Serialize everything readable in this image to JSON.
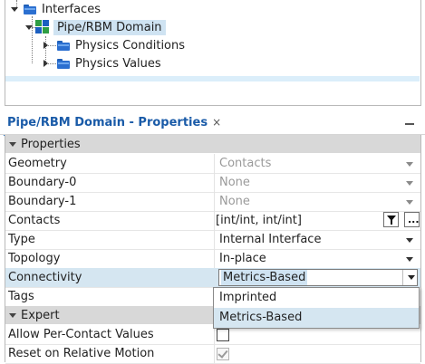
{
  "tree": {
    "items": [
      {
        "label": "Interfaces",
        "icon": "folder-icon"
      },
      {
        "label": "Pipe/RBM Domain",
        "icon": "domain-icon",
        "selected": true
      },
      {
        "label": "Physics Conditions",
        "icon": "folder-icon"
      },
      {
        "label": "Physics Values",
        "icon": "folder-icon"
      }
    ]
  },
  "panel": {
    "title": "Pipe/RBM Domain - Properties",
    "close_glyph": "×",
    "minimize_glyph": "_"
  },
  "groups": {
    "properties": "Properties",
    "expert": "Expert"
  },
  "props": {
    "geometry": {
      "name": "Geometry",
      "value": "Contacts"
    },
    "boundary0": {
      "name": "Boundary-0",
      "value": "None"
    },
    "boundary1": {
      "name": "Boundary-1",
      "value": "None"
    },
    "contacts": {
      "name": "Contacts",
      "value": "[int/int, int/int]",
      "ellipsis": "..."
    },
    "type": {
      "name": "Type",
      "value": "Internal Interface"
    },
    "topology": {
      "name": "Topology",
      "value": "In-place"
    },
    "connectivity": {
      "name": "Connectivity",
      "value": "Metrics-Based"
    },
    "tags": {
      "name": "Tags"
    },
    "allow_per_contact": {
      "name": "Allow Per-Contact Values",
      "checked": false
    },
    "reset_relative_motion": {
      "name": "Reset on Relative Motion",
      "checked": true
    }
  },
  "dropdown": {
    "options": [
      "Imprinted",
      "Metrics-Based"
    ],
    "highlighted": "Metrics-Based"
  },
  "colors": {
    "accent": "#1f73c8",
    "selection": "#d5e6f1",
    "group_header": "#d8d8d8",
    "domain_icon": [
      "#2f9e44",
      "#1c5fc0"
    ]
  }
}
